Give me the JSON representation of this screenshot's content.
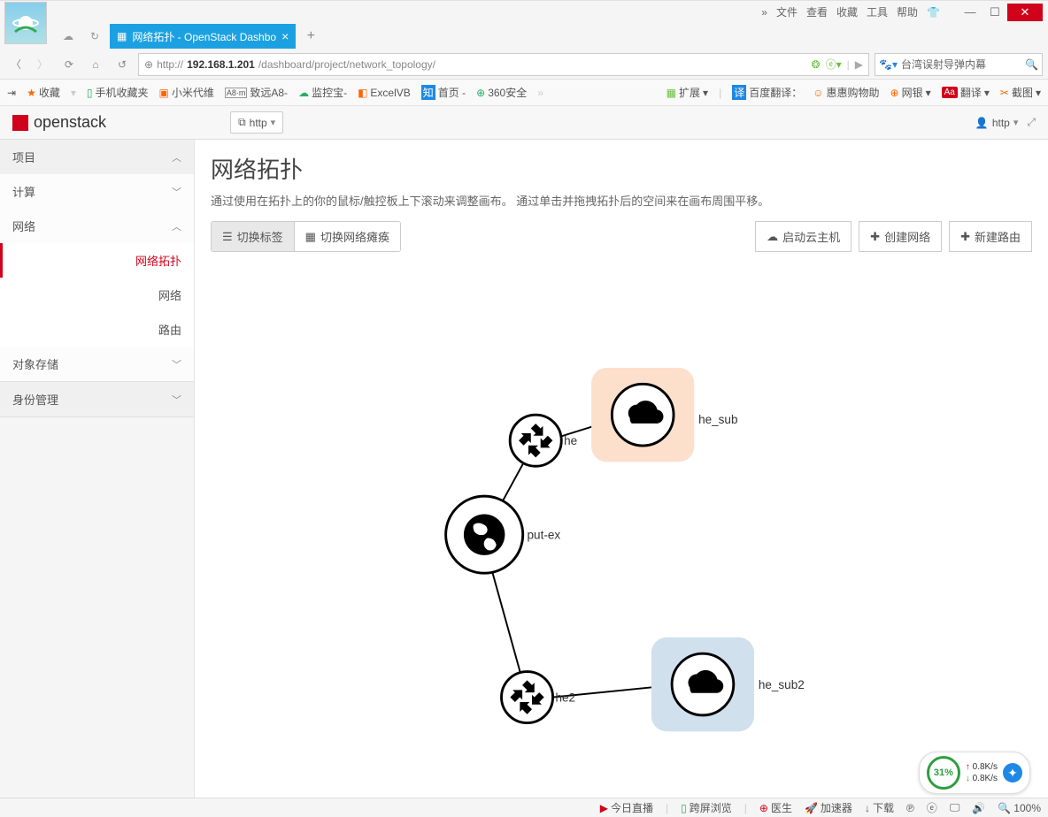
{
  "browser": {
    "menubar": [
      "文件",
      "查看",
      "收藏",
      "工具",
      "帮助"
    ],
    "tab_title": "网络拓扑 - OpenStack Dashbo",
    "url_display_prefix": "http://",
    "url_display_host": "192.168.1.201",
    "url_display_path": "/dashboard/project/network_topology/",
    "search_placeholder": "台湾误射导弹内幕",
    "bookmarks": {
      "favorites": "收藏",
      "mobile": "手机收藏夹",
      "xiaomi": "小米代维",
      "zhiyuan": "致远A8-",
      "jiankong": "监控宝-",
      "excelvb": "ExcelVB",
      "shouye": "首页 -",
      "safe360": "360安全",
      "extensions": "扩展",
      "translate_label": "百度翻译：",
      "huihui": "惠惠购物助",
      "netbank": "网银",
      "translate2": "翻译",
      "screenshot": "截图"
    }
  },
  "header": {
    "brand": "openstack",
    "domain_label": "http",
    "user_label": "http"
  },
  "sidebar": {
    "project": "项目",
    "compute": "计算",
    "network": "网络",
    "items": {
      "topology": "网络拓扑",
      "networks": "网络",
      "routers": "路由"
    },
    "object_storage": "对象存储",
    "identity": "身份管理"
  },
  "page": {
    "title": "网络拓扑",
    "subtitle": "通过使用在拓扑上的你的鼠标/触控板上下滚动来调整画布。 通过单击并拖拽拓扑后的空间来在画布周围平移。",
    "toggle_labels": "切换标签",
    "toggle_collapse": "切换网络瘫痪",
    "launch_instance": "启动云主机",
    "create_network": "创建网络",
    "create_router": "新建路由"
  },
  "topology": {
    "nodes": {
      "he": "he",
      "put_ex": "put-ex",
      "he2": "he2",
      "he_sub": "he_sub",
      "he_sub2": "he_sub2"
    }
  },
  "status": {
    "today_live": "今日直播",
    "cross_screen": "跨屏浏览",
    "doctor": "医生",
    "accelerator": "加速器",
    "download": "下载",
    "zoom": "100%"
  },
  "speed": {
    "percent": "31%",
    "up": "0.8K/s",
    "down": "0.8K/s"
  }
}
